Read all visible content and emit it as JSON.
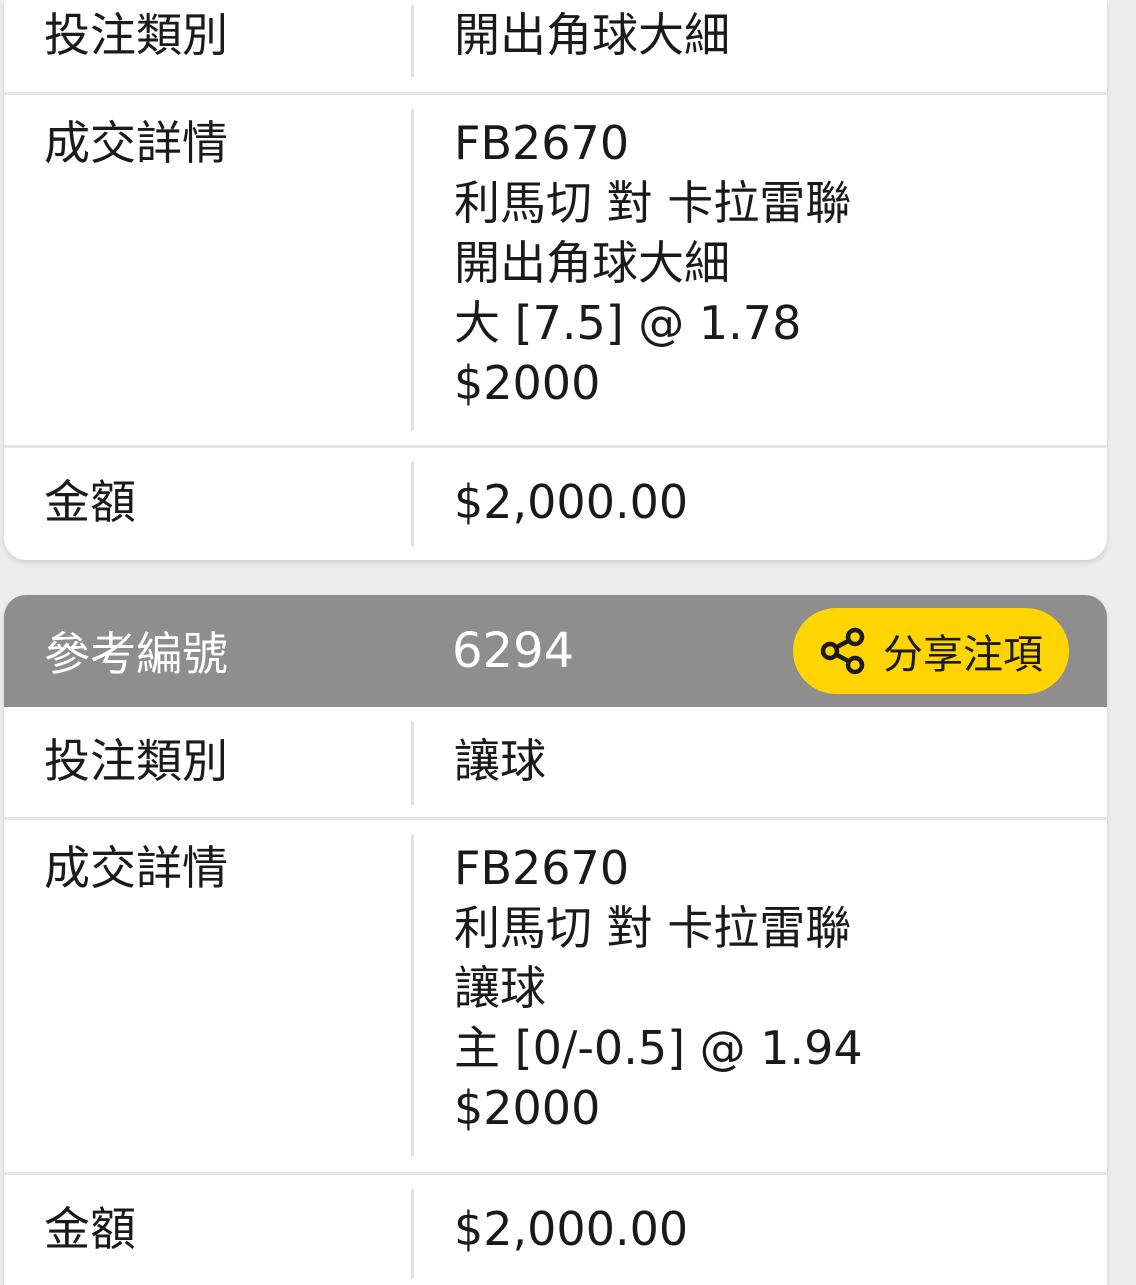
{
  "bet1": {
    "type_label": "投注類別",
    "type_value": "開出角球大細",
    "details_label": "成交詳情",
    "details": [
      "FB2670",
      "利馬切 對 卡拉雷聯",
      "開出角球大細",
      "大 [7.5] @ 1.78",
      "$2000"
    ],
    "amount_label": "金額",
    "amount_value": "$2,000.00"
  },
  "bet2": {
    "ref_label": "參考編號",
    "ref_value": "6294",
    "share_label": "分享注項",
    "share_icon": "share-icon",
    "type_label": "投注類別",
    "type_value": "讓球",
    "details_label": "成交詳情",
    "details": [
      "FB2670",
      "利馬切 對 卡拉雷聯",
      "讓球",
      "主 [0/-0.5] @ 1.94",
      "$2000"
    ],
    "amount_label": "金額",
    "amount_value": "$2,000.00"
  },
  "colors": {
    "accent": "#ffd400",
    "header_bg": "#8e8e8e",
    "page_bg": "#ededed"
  }
}
